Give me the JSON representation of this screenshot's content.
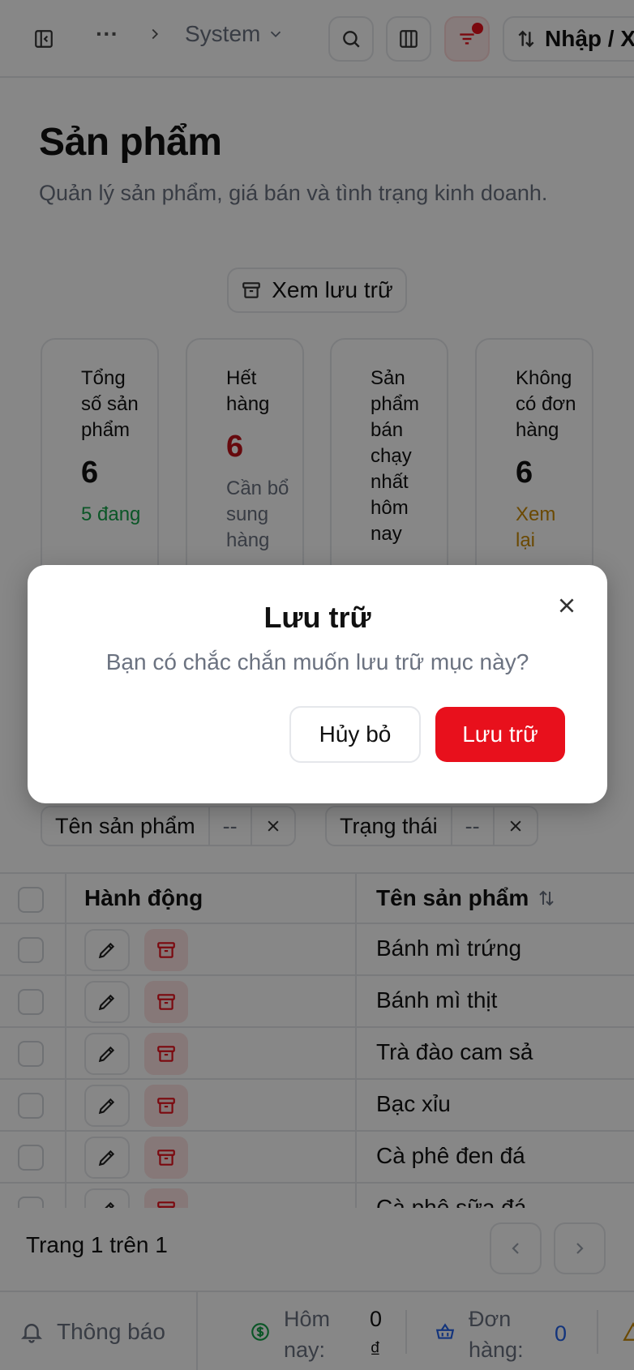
{
  "topbar": {
    "sidebar_toggle_icon": "sidebar-icon",
    "more_label": "···",
    "breadcrumb_current": "System",
    "import_label": "Nhập / X"
  },
  "header": {
    "title": "Sản phẩm",
    "description": "Quản lý sản phẩm, giá bán và tình trạng kinh doanh.",
    "archive_view_label": "Xem lưu trữ"
  },
  "stats": [
    {
      "label": "Tổng số sản phẩm",
      "value": "6",
      "sub": "5 đang",
      "value_color": "#111111",
      "sub_color": "#16a34a"
    },
    {
      "label": "Hết hàng",
      "value": "6",
      "sub": "Cần bổ sung hàng",
      "value_color": "#c0111a",
      "sub_color": "#6b7280"
    },
    {
      "label": "Sản phẩm bán chạy nhất hôm nay",
      "value": "",
      "sub": "",
      "value_color": "#111111",
      "sub_color": "#6b7280"
    },
    {
      "label": "Không có đơn hàng",
      "value": "6",
      "sub": "Xem lại",
      "value_color": "#111111",
      "sub_color": "#ca8a04"
    }
  ],
  "filters": [
    {
      "field": "Tên sản phẩm",
      "value": "--"
    },
    {
      "field": "Trạng thái",
      "value": "--"
    }
  ],
  "table": {
    "col_actions": "Hành động",
    "col_name": "Tên sản phẩm",
    "rows": [
      {
        "name": "Bánh mì trứng"
      },
      {
        "name": "Bánh mì thịt"
      },
      {
        "name": "Trà đào cam sả"
      },
      {
        "name": "Bạc xỉu"
      },
      {
        "name": "Cà phê đen đá"
      },
      {
        "name": "Cà phê sữa đá"
      }
    ]
  },
  "pagination": {
    "text": "Trang 1 trên 1"
  },
  "bottombar": {
    "notify_label": "Thông báo",
    "today_label": "Hôm nay:",
    "today_value": "0 ₫",
    "orders_label": "Đơn hàng:",
    "orders_value": "0"
  },
  "dialog": {
    "title": "Lưu trữ",
    "message": "Bạn có chắc chắn muốn lưu trữ mục này?",
    "cancel_label": "Hủy bỏ",
    "confirm_label": "Lưu trữ"
  },
  "colors": {
    "accent_red": "#e8101c",
    "border": "#e5e7eb",
    "muted": "#6b7280"
  }
}
